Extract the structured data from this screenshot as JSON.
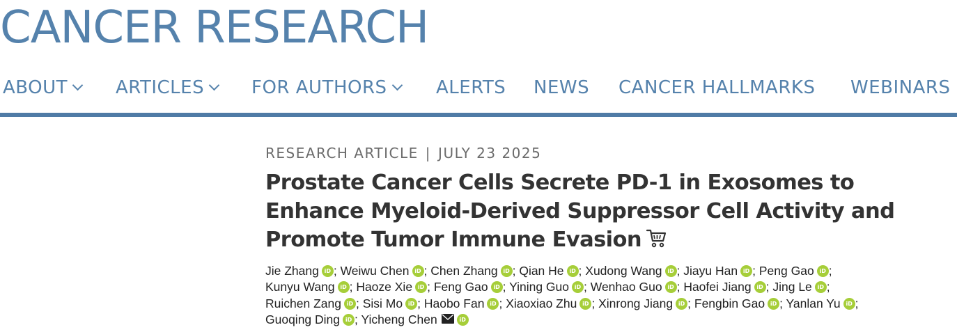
{
  "site": {
    "logo": "CANCER RESEARCH"
  },
  "nav": {
    "about": "ABOUT",
    "articles": "ARTICLES",
    "for_authors": "FOR AUTHORS",
    "alerts": "ALERTS",
    "news": "NEWS",
    "cancer_hallmarks": "CANCER HALLMARKS",
    "webinars": "WEBINARS"
  },
  "article": {
    "type": "RESEARCH ARTICLE",
    "separator": "|",
    "date": "JULY 23 2025",
    "title": "Prostate Cancer Cells Secrete PD-1 in Exosomes to Enhance Myeloid-Derived Suppressor Cell Activity and Promote Tumor Immune Evasion",
    "authors": [
      "Jie Zhang",
      "Weiwu Chen",
      "Chen Zhang",
      "Qian He",
      "Xudong Wang",
      "Jiayu Han",
      "Peng Gao",
      "Kunyu Wang",
      "Haoze Xie",
      "Feng Gao",
      "Yining Guo",
      "Wenhao Guo",
      "Haofei Jiang",
      "Jing Le",
      "Ruichen Zang",
      "Sisi Mo",
      "Haobo Fan",
      "Xiaoxiao Zhu",
      "Xinrong Jiang",
      "Fengbin Gao",
      "Yanlan Yu",
      "Guoqing Ding",
      "Yicheng Chen"
    ],
    "orcid_label": "iD",
    "separator_char": ";"
  },
  "colors": {
    "brand": "#5582ac",
    "rule": "#4f7ba6",
    "orcid": "#a6ce39",
    "title": "#333333"
  },
  "icons": {
    "cart": "cart-icon",
    "mail": "mail-icon",
    "orcid": "orcid-icon",
    "dropdown": "chevron-down-icon"
  }
}
